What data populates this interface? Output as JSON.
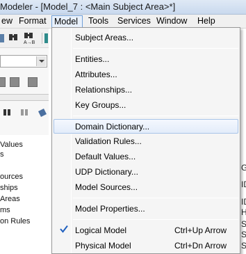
{
  "window": {
    "title": "Modeler - [Model_7 : <Main Subject Area>*]"
  },
  "menubar": {
    "items": [
      {
        "label": "ew"
      },
      {
        "label": "Format"
      },
      {
        "label": "Model"
      },
      {
        "label": "Tools"
      },
      {
        "label": "Services"
      },
      {
        "label": "Window"
      },
      {
        "label": "Help"
      }
    ]
  },
  "tree": {
    "items": [
      {
        "label": "Values"
      },
      {
        "label": "s"
      },
      {
        "label": "ources"
      },
      {
        "label": "ships"
      },
      {
        "label": "Areas"
      },
      {
        "label": "ms"
      },
      {
        "label": "on Rules"
      }
    ]
  },
  "right_edge_chars": [
    "G",
    "ID",
    "ID",
    "H",
    "S",
    "S",
    "S"
  ],
  "model_menu": {
    "items": [
      {
        "label": "Subject Areas..."
      },
      {
        "label": "Entities..."
      },
      {
        "label": "Attributes..."
      },
      {
        "label": "Relationships..."
      },
      {
        "label": "Key Groups..."
      },
      {
        "label": "Domain Dictionary..."
      },
      {
        "label": "Validation Rules..."
      },
      {
        "label": "Default Values..."
      },
      {
        "label": "UDP Dictionary..."
      },
      {
        "label": "Model Sources..."
      },
      {
        "label": "Model Properties..."
      },
      {
        "label": "Logical Model",
        "shortcut": "Ctrl+Up Arrow",
        "checked": true
      },
      {
        "label": "Physical Model",
        "shortcut": "Ctrl+Dn Arrow"
      }
    ]
  },
  "colors": {
    "highlight_border": "#a8c4e8",
    "check": "#1f5fbf"
  }
}
